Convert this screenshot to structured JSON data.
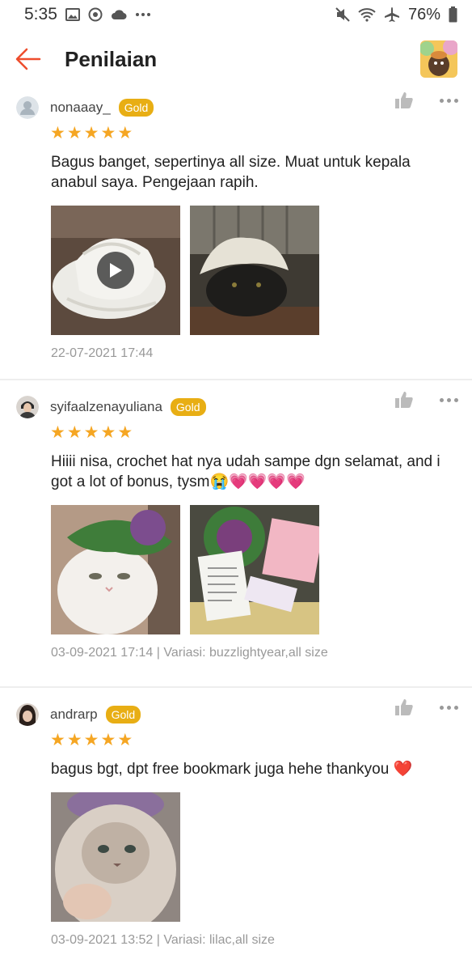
{
  "status_bar": {
    "time": "5:35",
    "battery": "76%"
  },
  "header": {
    "title": "Penilaian"
  },
  "reviews": [
    {
      "username": "nonaaay_",
      "badge": "Gold",
      "text": "Bagus banget, sepertinya all size. Muat untuk kepala anabul saya. Pengejaan rapih.",
      "date": "22-07-2021 17:44",
      "variation": ""
    },
    {
      "username": "syifaalzenayuliana",
      "badge": "Gold",
      "text": "Hiiii nisa, crochet hat nya udah sampe dgn selamat, and i got a lot of bonus, tysm😭💗💗💗💗",
      "date": "03-09-2021 17:14",
      "variation": "Variasi: buzzlightyear,all size"
    },
    {
      "username": "andrarp",
      "badge": "Gold",
      "text": "bagus bgt, dpt free bookmark juga hehe thankyou ❤️",
      "date": "03-09-2021 13:52",
      "variation": "Variasi: lilac,all size"
    }
  ],
  "colors": {
    "accent": "#ee4d2d",
    "gold": "#e8ae14",
    "star": "#f5a623"
  }
}
